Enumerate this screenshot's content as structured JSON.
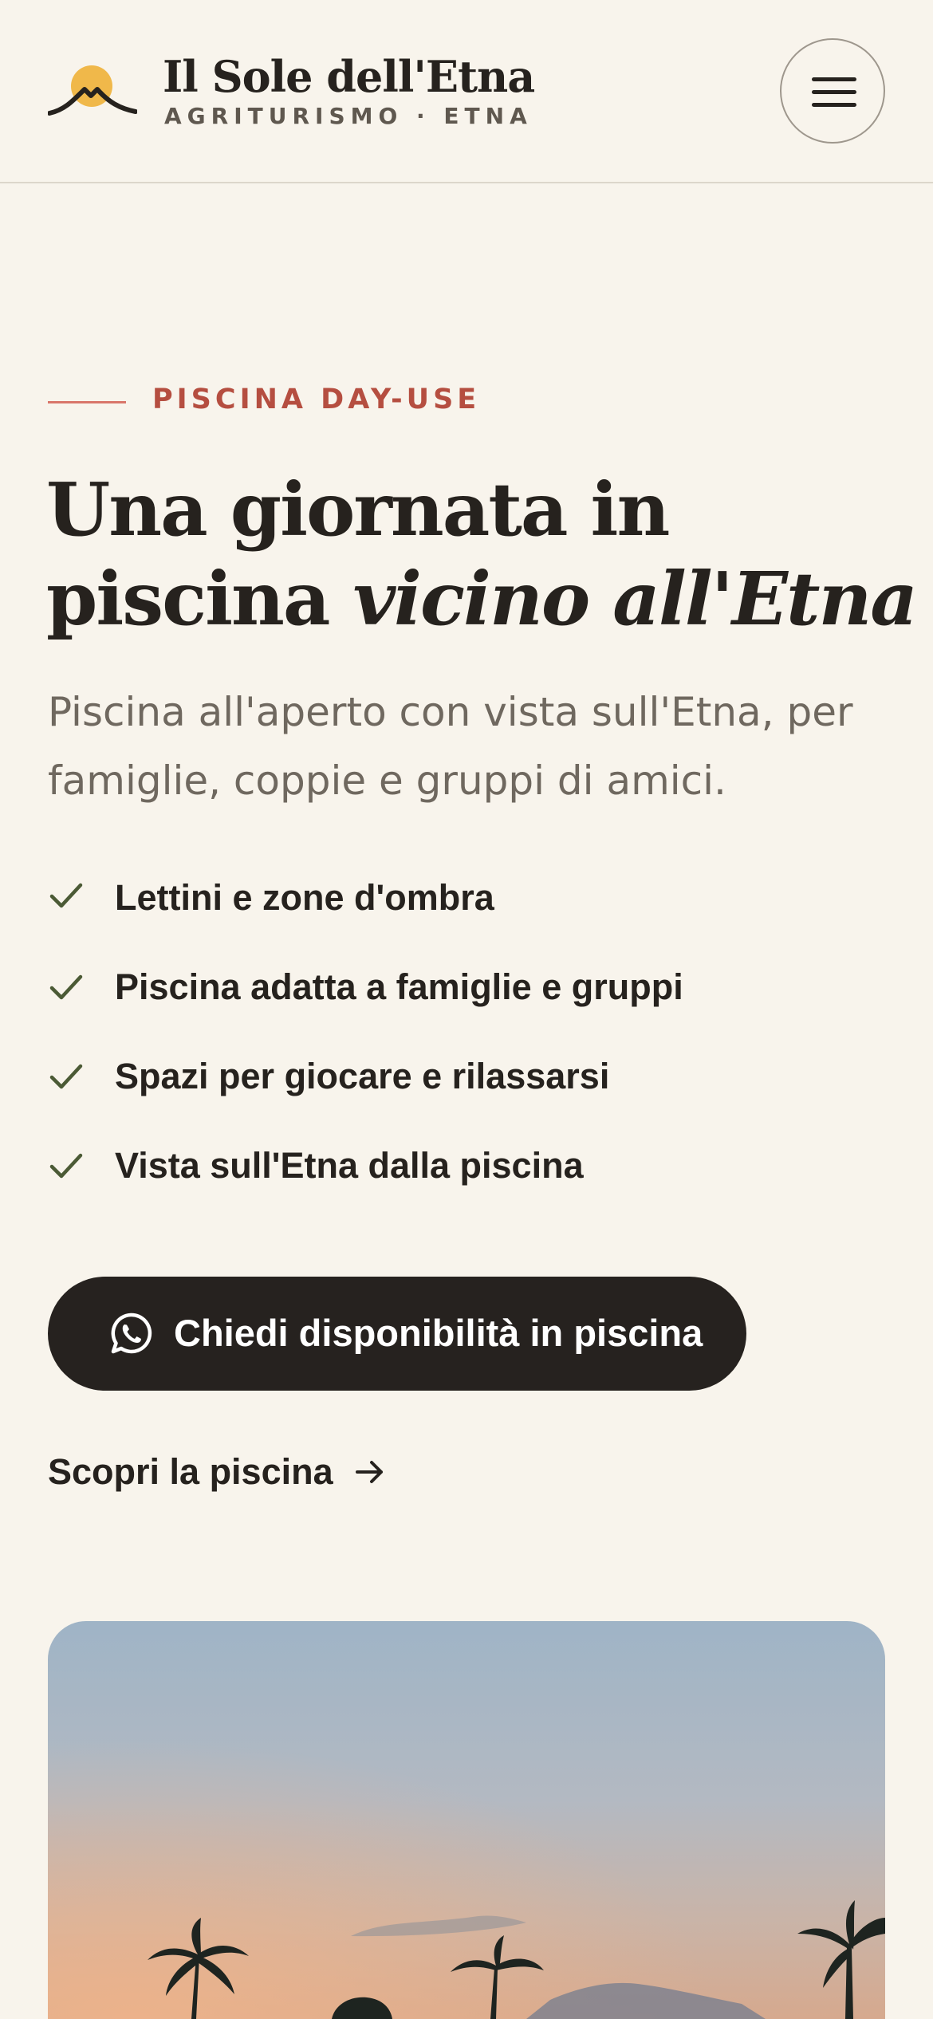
{
  "header": {
    "brand_name": "Il Sole dell'Etna",
    "brand_tagline": "AGRITURISMO · ETNA",
    "logo_icon": "sun-over-volcano-logo",
    "menu_icon": "hamburger-menu-icon"
  },
  "hero": {
    "eyebrow": "PISCINA DAY-USE",
    "title_line1": "Una giornata in",
    "title_line2_regular": "piscina ",
    "title_line2_italic": "vicino all'Etna",
    "subtitle": "Piscina all'aperto con vista sull'Etna, per famiglie, coppie e gruppi di amici.",
    "features": [
      {
        "label": "Lettini e zone d'ombra",
        "icon": "check-icon"
      },
      {
        "label": "Piscina adatta a famiglie e gruppi",
        "icon": "check-icon"
      },
      {
        "label": "Spazi per giocare e rilassarsi",
        "icon": "check-icon"
      },
      {
        "label": "Vista sull'Etna dalla piscina",
        "icon": "check-icon"
      }
    ],
    "cta_label": "Chiedi disponibilità in piscina",
    "cta_icon": "whatsapp-icon",
    "link_label": "Scopri la piscina",
    "link_icon": "arrow-right-icon"
  },
  "image": {
    "subject": "pool-area-photo"
  },
  "colors": {
    "background": "#f8f4ec",
    "text": "#26221e",
    "accent": "#b54e40",
    "button": "#26221f",
    "check": "#4b5a35",
    "sun": "#f0b84a"
  }
}
